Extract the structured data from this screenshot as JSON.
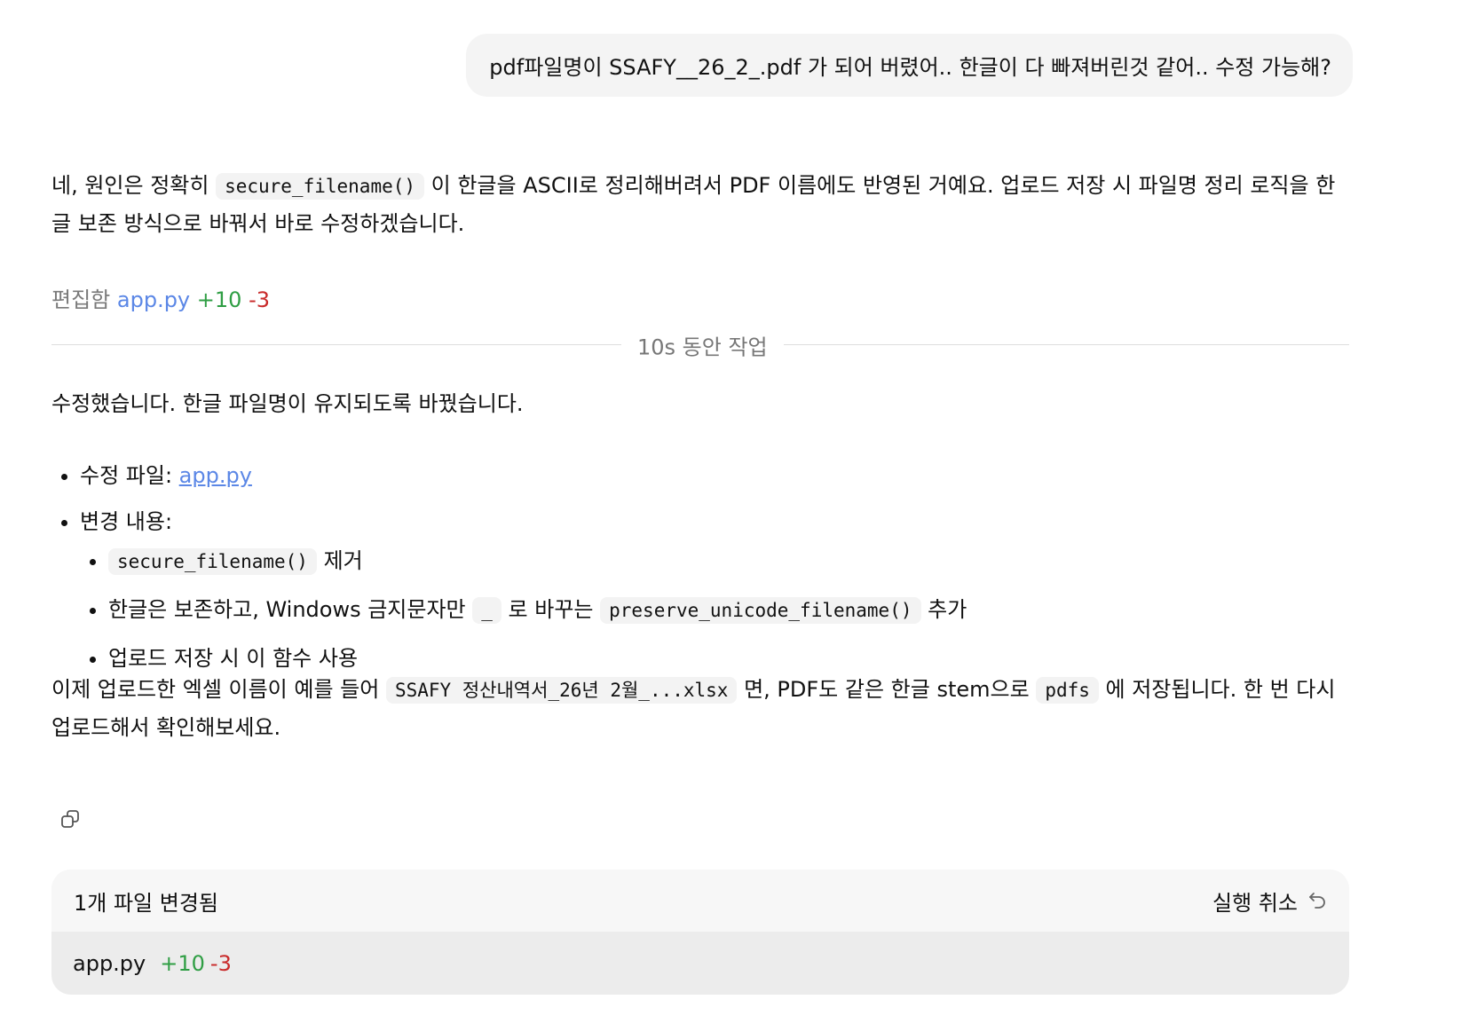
{
  "user_message": "pdf파일명이 SSAFY__26_2_.pdf 가 되어 버렸어.. 한글이 다 빠져버린것 같어.. 수정 가능해?",
  "reply_intro": {
    "before_code": "네, 원인은 정확히 ",
    "code": "secure_filename()",
    "after_code": " 이 한글을 ASCII로 정리해버려서 PDF 이름에도 반영된 거예요. 업로드 저장 시 파일명 정리 로직을 한글 보존 방식으로 바꿔서 바로 수정하겠습니다."
  },
  "edit_summary": {
    "label": "편집함",
    "file": "app.py",
    "added": "+10",
    "removed": "-3"
  },
  "work_divider": "10s 동안 작업",
  "result_text": "수정했습니다. 한글 파일명이 유지되도록 바꿨습니다.",
  "bullets": {
    "file_label": "수정 파일: ",
    "file_link": "app.py",
    "changes_label": "변경 내용:",
    "sub1_code": "secure_filename()",
    "sub1_text": " 제거",
    "sub2_before": "한글은 보존하고, Windows 금지문자만 ",
    "sub2_code1": "_",
    "sub2_mid": " 로 바꾸는 ",
    "sub2_code2": "preserve_unicode_filename()",
    "sub2_after": " 추가",
    "sub3_text": "업로드 저장 시 이 함수 사용"
  },
  "closing": {
    "before_code": "이제 업로드한 엑셀 이름이 예를 들어 ",
    "code1": "SSAFY 정산내역서_26년 2월_...xlsx",
    "mid": " 면, PDF도 같은 한글 stem으로 ",
    "code2": "pdfs",
    "after": " 에 저장됩니다. 한 번 다시 업로드해서 확인해보세요."
  },
  "changes_card": {
    "title": "1개 파일 변경됨",
    "undo_label": "실행 취소",
    "file": "app.py",
    "added": "+10",
    "removed": "-3"
  },
  "icons": {
    "copy": "copy-icon",
    "undo": "undo-icon"
  },
  "colors": {
    "link": "#5b87e6",
    "added": "#2f9e44",
    "removed": "#c92a2a",
    "bubble_bg": "#f4f4f4",
    "card_bg": "#f7f7f7"
  }
}
